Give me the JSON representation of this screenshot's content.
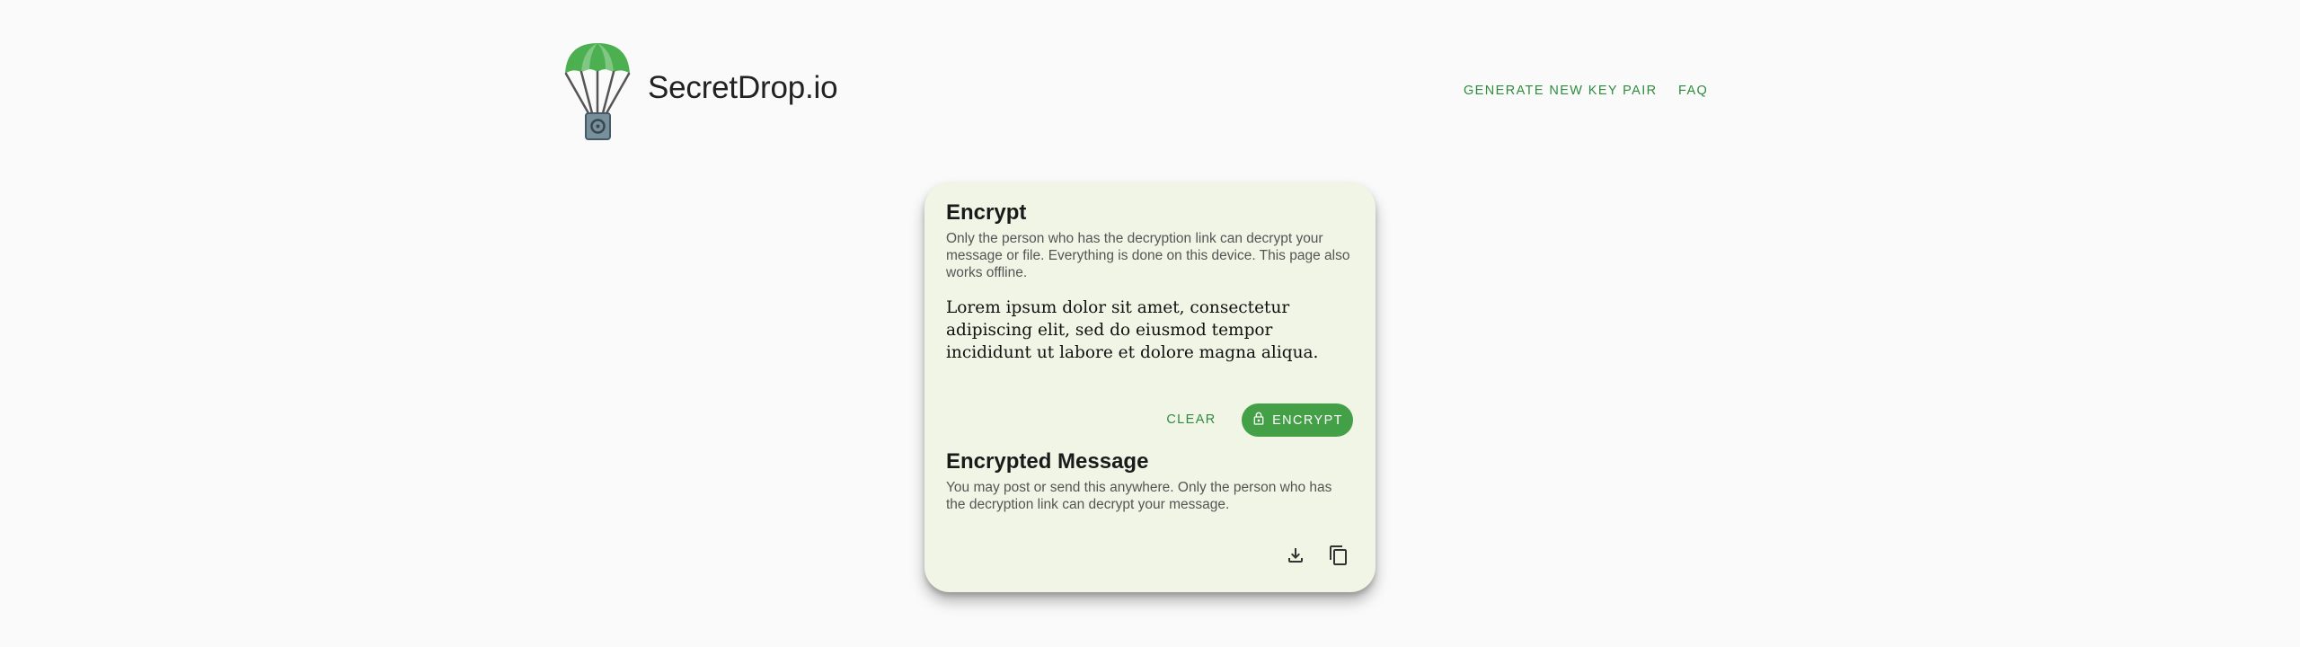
{
  "header": {
    "brand": "SecretDrop.io",
    "nav": {
      "generate_label": "GENERATE NEW KEY PAIR",
      "faq_label": "FAQ"
    },
    "logo_icon": "parachute-safe-logo"
  },
  "encrypt": {
    "title": "Encrypt",
    "description": "Only the person who has the decryption link can decrypt your message or file. Everything is done on this device. This page also works offline.",
    "message_value": "Lorem ipsum dolor sit amet, consectetur adipiscing elit, sed do eiusmod tempor incididunt ut labore et dolore magna aliqua.",
    "clear_label": "CLEAR",
    "encrypt_label": "ENCRYPT",
    "encrypt_icon": "lock-icon"
  },
  "encrypted_message": {
    "title": "Encrypted Message",
    "description": "You may post or send this anywhere. Only the person who has the decryption link can decrypt your message.",
    "download_icon": "download-icon",
    "copy_icon": "copy-icon"
  },
  "colors": {
    "accent": "#43a047",
    "accent_text": "#2e8b3e",
    "card_bg": "#f0f5e6",
    "page_bg": "#fafafa"
  }
}
